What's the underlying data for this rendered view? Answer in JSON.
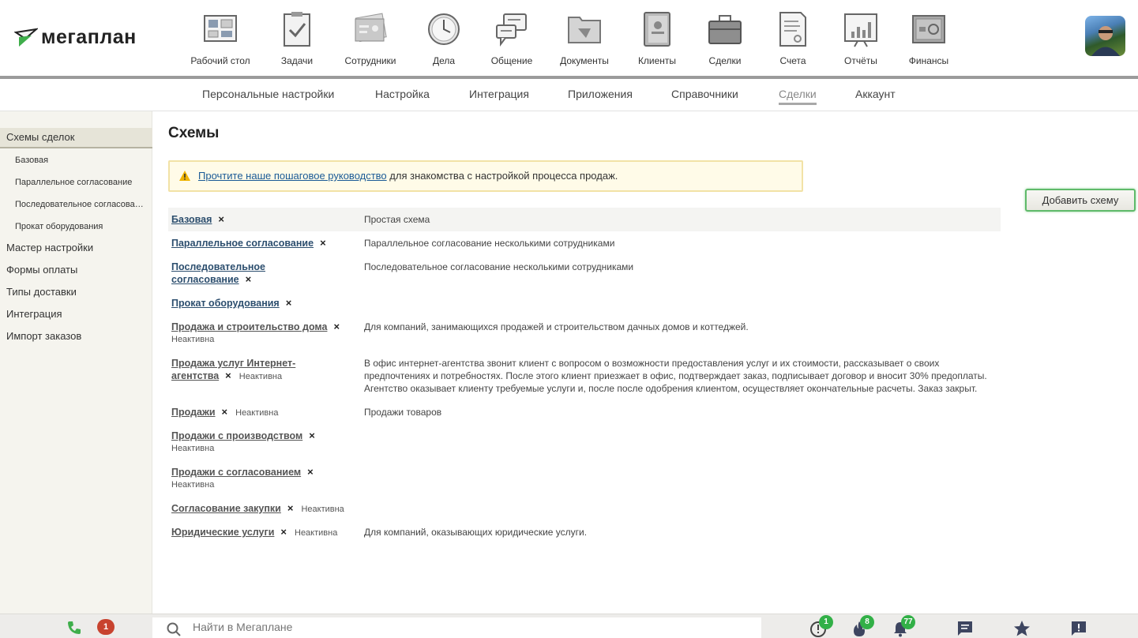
{
  "brand": {
    "logo_text": "мегаплан"
  },
  "nav": [
    {
      "label": "Рабочий стол",
      "icon": "desktop-icon"
    },
    {
      "label": "Задачи",
      "icon": "tasks-icon"
    },
    {
      "label": "Сотрудники",
      "icon": "employees-icon"
    },
    {
      "label": "Дела",
      "icon": "clock-icon"
    },
    {
      "label": "Общение",
      "icon": "chat-icon"
    },
    {
      "label": "Документы",
      "icon": "folder-icon"
    },
    {
      "label": "Клиенты",
      "icon": "contacts-icon"
    },
    {
      "label": "Сделки",
      "icon": "briefcase-icon"
    },
    {
      "label": "Счета",
      "icon": "invoice-icon"
    },
    {
      "label": "Отчёты",
      "icon": "reports-icon"
    },
    {
      "label": "Финансы",
      "icon": "safe-icon"
    }
  ],
  "subnav": [
    {
      "label": "Персональные настройки",
      "active": false
    },
    {
      "label": "Настройка",
      "active": false
    },
    {
      "label": "Интеграция",
      "active": false
    },
    {
      "label": "Приложения",
      "active": false
    },
    {
      "label": "Справочники",
      "active": false
    },
    {
      "label": "Сделки",
      "active": true
    },
    {
      "label": "Аккаунт",
      "active": false
    }
  ],
  "sidebar": {
    "items": [
      {
        "label": "Схемы сделок",
        "active": true,
        "sub": false
      },
      {
        "label": "Базовая",
        "active": false,
        "sub": true
      },
      {
        "label": "Параллельное согласование",
        "active": false,
        "sub": true
      },
      {
        "label": "Последовательное согласование",
        "active": false,
        "sub": true
      },
      {
        "label": "Прокат оборудования",
        "active": false,
        "sub": true
      },
      {
        "label": "Мастер настройки",
        "active": false,
        "sub": false
      },
      {
        "label": "Формы оплаты",
        "active": false,
        "sub": false
      },
      {
        "label": "Типы доставки",
        "active": false,
        "sub": false
      },
      {
        "label": "Интеграция",
        "active": false,
        "sub": false
      },
      {
        "label": "Импорт заказов",
        "active": false,
        "sub": false
      }
    ]
  },
  "main": {
    "title": "Схемы",
    "notice": {
      "link_text": "Прочтите наше пошаговое руководство",
      "rest_text": " для знакомства с настройкой процесса продаж."
    },
    "add_button": "Добавить схему",
    "delete_glyph": "×",
    "schemes": [
      {
        "name": "Базовая",
        "status": "",
        "description": "Простая схема"
      },
      {
        "name": "Параллельное согласование",
        "status": "",
        "description": "Параллельное согласование несколькими сотрудниками"
      },
      {
        "name": "Последовательное согласование",
        "status": "",
        "description": "Последовательное согласование несколькими сотрудниками"
      },
      {
        "name": "Прокат оборудования",
        "status": "",
        "description": ""
      },
      {
        "name": "Продажа и строительство дома",
        "status": "Неактивна",
        "description": "Для компаний, занимающихся продажей и строительством дачных домов и коттеджей."
      },
      {
        "name": "Продажа услуг Интернет-агентства",
        "status": "Неактивна",
        "description": "В офис интернет-агентства звонит клиент с вопросом о возможности предоставления услуг и их стоимости, рассказывает о своих предпочтениях и потребностях. После этого клиент приезжает в офис, подтверждает заказ, подписывает договор и вносит 30% предоплаты. Агентство оказывает клиенту требуемые услуги и, после после одобрения клиентом, осуществляет окончательные расчеты. Заказ закрыт."
      },
      {
        "name": "Продажи",
        "status": "Неактивна",
        "description": "Продажи товаров"
      },
      {
        "name": "Продажи с производством",
        "status": "Неактивна",
        "description": ""
      },
      {
        "name": "Продажи с согласованием",
        "status": "Неактивна",
        "description": ""
      },
      {
        "name": "Согласование закупки",
        "status": "Неактивна",
        "description": ""
      },
      {
        "name": "Юридические услуги",
        "status": "Неактивна",
        "description": "Для компаний, оказывающих юридические услуги."
      }
    ]
  },
  "bottom": {
    "calls_badge": "1",
    "search_placeholder": "Найти в Мегаплане",
    "alerts_badge": "1",
    "hot_badge": "8",
    "notifications_badge": "77"
  },
  "colors": {
    "accent_green": "#32b047",
    "link": "#2c4e6e",
    "badge_red": "#c8432f"
  }
}
